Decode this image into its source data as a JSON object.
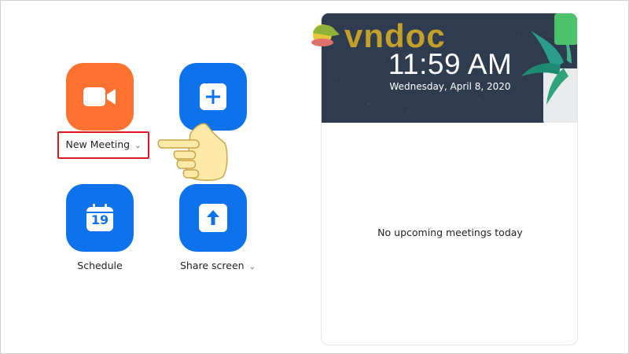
{
  "actions": {
    "new_meeting": {
      "label": "New Meeting",
      "icon": "video-camera-icon",
      "color": "#fd7231"
    },
    "join": {
      "icon": "plus-icon",
      "color": "#0e72ed"
    },
    "schedule": {
      "label": "Schedule",
      "icon": "calendar-icon",
      "day": "19",
      "color": "#0e72ed"
    },
    "share_screen": {
      "label": "Share screen",
      "icon": "arrow-up-icon",
      "color": "#0e72ed"
    }
  },
  "header_card": {
    "time": "11:59 AM",
    "date": "Wednesday, April 8, 2020"
  },
  "meetings": {
    "empty_message": "No upcoming meetings today"
  },
  "watermark": {
    "brand": "vndoc"
  },
  "colors": {
    "highlight": "#d71920",
    "header_bg": "#2e3b4e"
  }
}
